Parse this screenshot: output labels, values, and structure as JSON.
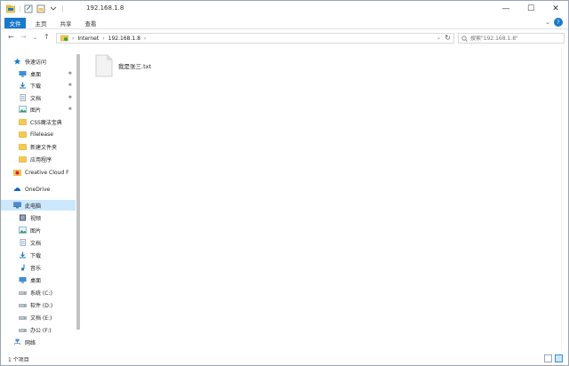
{
  "window": {
    "title": "192.168.1.8",
    "controls": {
      "minimize": "—",
      "maximize": "☐",
      "close": "✕"
    }
  },
  "ribbon": {
    "tabs": [
      "文件",
      "主页",
      "共享",
      "查看"
    ],
    "help": "?",
    "expand": "⌄"
  },
  "nav": {
    "back": "←",
    "forward": "→",
    "recent": "⌄",
    "up": "↑",
    "breadcrumb": [
      "Internet",
      "192.168.1.8"
    ],
    "search_placeholder": "搜索\"192.168.1.8\""
  },
  "sidebar": {
    "items": [
      {
        "label": "快速访问",
        "icon": "star-icon",
        "pinned": false
      },
      {
        "label": "桌面",
        "icon": "desktop-icon",
        "pinned": true
      },
      {
        "label": "下载",
        "icon": "download-icon",
        "pinned": true
      },
      {
        "label": "文档",
        "icon": "document-icon",
        "pinned": true
      },
      {
        "label": "图片",
        "icon": "pictures-icon",
        "pinned": true
      },
      {
        "label": "CSS魔法宝典",
        "icon": "folder-icon",
        "pinned": false
      },
      {
        "label": "Filelease",
        "icon": "folder-icon",
        "pinned": false
      },
      {
        "label": "新建文件夹",
        "icon": "folder-icon",
        "pinned": false
      },
      {
        "label": "应用程序",
        "icon": "folder-icon",
        "pinned": false
      },
      {
        "label": "Creative Cloud F",
        "icon": "creative-cloud-icon",
        "pinned": false
      },
      {
        "label": "OneDrive",
        "icon": "onedrive-icon",
        "pinned": false
      },
      {
        "label": "此电脑",
        "icon": "computer-icon",
        "pinned": false
      },
      {
        "label": "视频",
        "icon": "video-icon",
        "pinned": false
      },
      {
        "label": "图片",
        "icon": "pictures-icon",
        "pinned": false
      },
      {
        "label": "文档",
        "icon": "document-icon",
        "pinned": false
      },
      {
        "label": "下载",
        "icon": "download-icon",
        "pinned": false
      },
      {
        "label": "音乐",
        "icon": "music-icon",
        "pinned": false
      },
      {
        "label": "桌面",
        "icon": "desktop-icon",
        "pinned": false
      },
      {
        "label": "系统 (C:)",
        "icon": "drive-icon",
        "pinned": false
      },
      {
        "label": "软件 (D:)",
        "icon": "drive-icon",
        "pinned": false
      },
      {
        "label": "文档 (E:)",
        "icon": "drive-icon",
        "pinned": false
      },
      {
        "label": "办公 (F:)",
        "icon": "drive-icon",
        "pinned": false
      },
      {
        "label": "网络",
        "icon": "network-icon",
        "pinned": false
      }
    ],
    "pin_glyph": "✱"
  },
  "content": {
    "files": [
      {
        "name": "我是张三.txt",
        "icon": "text-file-icon"
      }
    ]
  },
  "status": {
    "count": "1 个项目"
  },
  "colors": {
    "accent": "#1979ca",
    "selection": "#cce8ff",
    "folder": "#f7c94c"
  }
}
